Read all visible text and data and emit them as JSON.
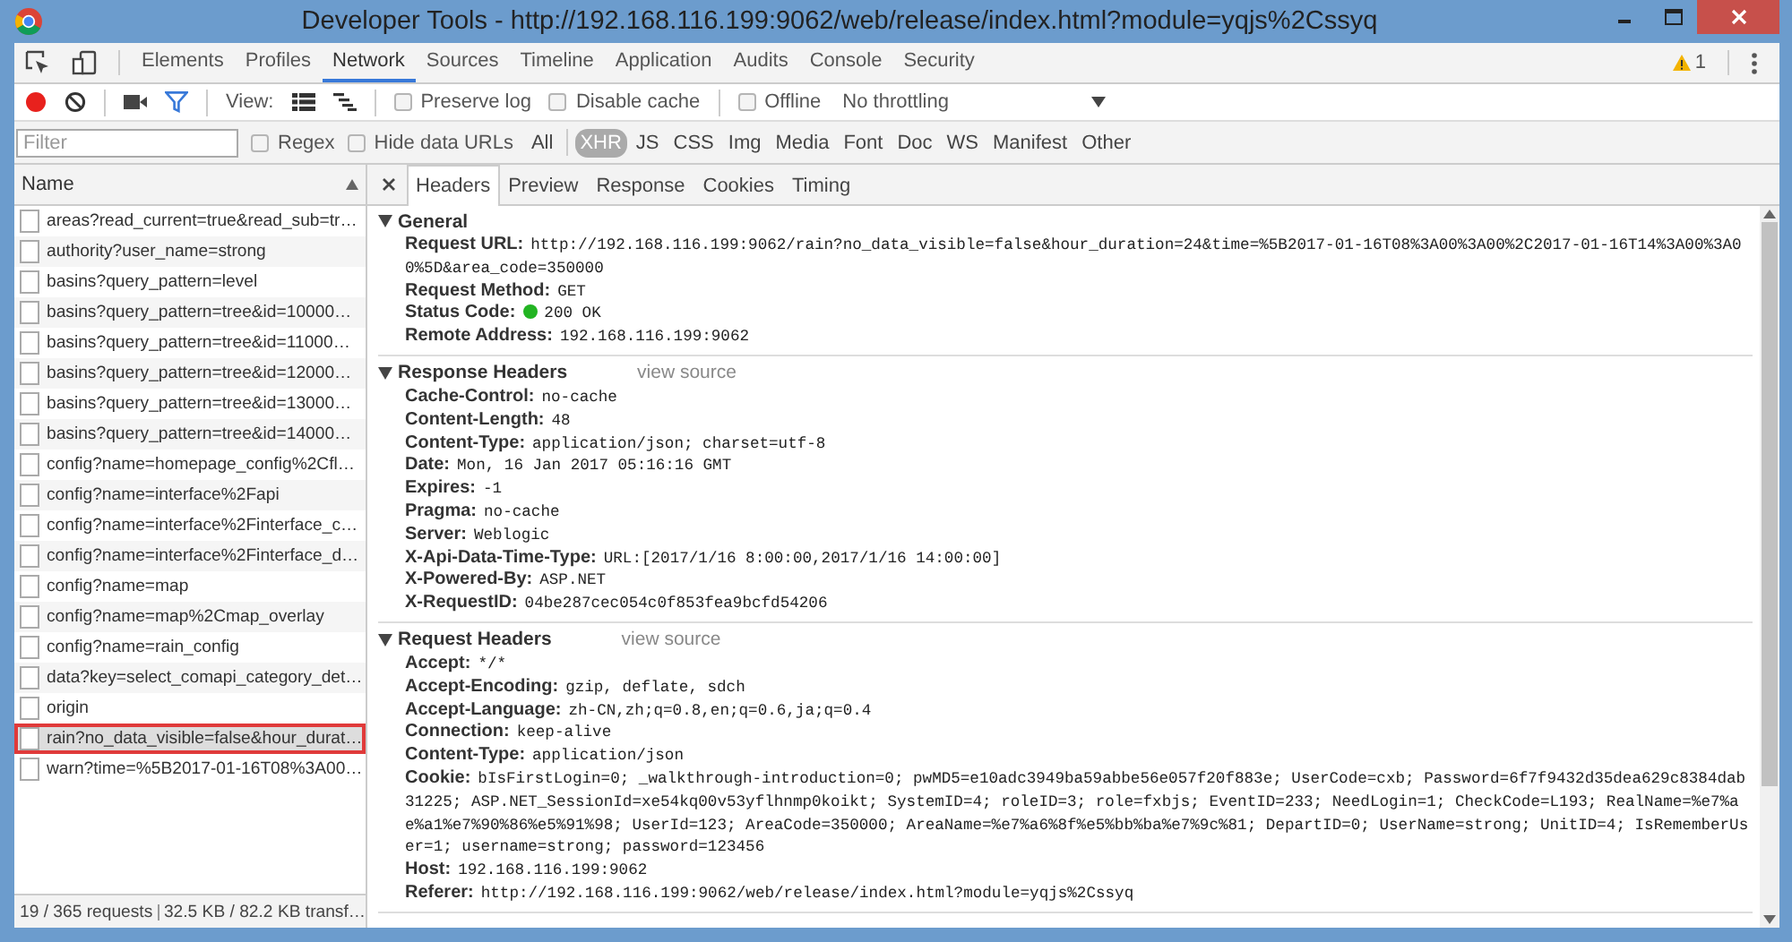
{
  "window": {
    "title": "Developer Tools - http://192.168.116.199:9062/web/release/index.html?module=yqjs%2Cssyq"
  },
  "tabs": [
    {
      "label": "Elements",
      "selected": false
    },
    {
      "label": "Profiles",
      "selected": false
    },
    {
      "label": "Network",
      "selected": true
    },
    {
      "label": "Sources",
      "selected": false
    },
    {
      "label": "Timeline",
      "selected": false
    },
    {
      "label": "Application",
      "selected": false
    },
    {
      "label": "Audits",
      "selected": false
    },
    {
      "label": "Console",
      "selected": false
    },
    {
      "label": "Security",
      "selected": false
    }
  ],
  "warning_count": "1",
  "toolbar": {
    "recording": true,
    "filter_active": true,
    "view_label": "View:",
    "options": [
      {
        "label": "Preserve log",
        "checked": false
      },
      {
        "label": "Disable cache",
        "checked": false
      },
      {
        "label": "Offline",
        "checked": false
      }
    ],
    "throttling": "No throttling"
  },
  "filter_bar": {
    "placeholder": "Filter",
    "options": [
      {
        "label": "Regex",
        "checked": false
      },
      {
        "label": "Hide data URLs",
        "checked": false
      }
    ],
    "types": [
      {
        "label": "All",
        "selected": false
      },
      {
        "label": "XHR",
        "selected": true
      },
      {
        "label": "JS",
        "selected": false
      },
      {
        "label": "CSS",
        "selected": false
      },
      {
        "label": "Img",
        "selected": false
      },
      {
        "label": "Media",
        "selected": false
      },
      {
        "label": "Font",
        "selected": false
      },
      {
        "label": "Doc",
        "selected": false
      },
      {
        "label": "WS",
        "selected": false
      },
      {
        "label": "Manifest",
        "selected": false
      },
      {
        "label": "Other",
        "selected": false
      }
    ]
  },
  "requests": {
    "column": "Name",
    "items": [
      {
        "name": "areas?read_current=true&read_sub=tr…",
        "selected": false
      },
      {
        "name": "authority?user_name=strong",
        "selected": false
      },
      {
        "name": "basins?query_pattern=level",
        "selected": false
      },
      {
        "name": "basins?query_pattern=tree&id=10000…",
        "selected": false
      },
      {
        "name": "basins?query_pattern=tree&id=11000…",
        "selected": false
      },
      {
        "name": "basins?query_pattern=tree&id=12000…",
        "selected": false
      },
      {
        "name": "basins?query_pattern=tree&id=13000…",
        "selected": false
      },
      {
        "name": "basins?query_pattern=tree&id=14000…",
        "selected": false
      },
      {
        "name": "config?name=homepage_config%2Cfl…",
        "selected": false
      },
      {
        "name": "config?name=interface%2Fapi",
        "selected": false
      },
      {
        "name": "config?name=interface%2Finterface_c…",
        "selected": false
      },
      {
        "name": "config?name=interface%2Finterface_d…",
        "selected": false
      },
      {
        "name": "config?name=map",
        "selected": false
      },
      {
        "name": "config?name=map%2Cmap_overlay",
        "selected": false
      },
      {
        "name": "config?name=rain_config",
        "selected": false
      },
      {
        "name": "data?key=select_comapi_category_det…",
        "selected": false
      },
      {
        "name": "origin",
        "selected": false
      },
      {
        "name": "rain?no_data_visible=false&hour_durat…",
        "selected": true
      },
      {
        "name": "warn?time=%5B2017-01-16T08%3A00…",
        "selected": false
      }
    ],
    "summary": "19 / 365 requests",
    "transfer": "32.5 KB / 82.2 KB transf…"
  },
  "details": {
    "tabs": [
      {
        "label": "Headers",
        "selected": true
      },
      {
        "label": "Preview",
        "selected": false
      },
      {
        "label": "Response",
        "selected": false
      },
      {
        "label": "Cookies",
        "selected": false
      },
      {
        "label": "Timing",
        "selected": false
      }
    ],
    "sections": [
      {
        "title": "General",
        "expanded": true,
        "rows": [
          {
            "key": "Request URL:",
            "value": "http://192.168.116.199:9062/rain?no_data_visible=false&hour_duration=24&time=%5B2017-01-16T08%3A00%3A00%2C2017-01-16T14%3A00%3A00%5D&area_code=350000"
          },
          {
            "key": "Request Method:",
            "value": "GET"
          },
          {
            "key": "Status Code:",
            "value": "200 OK",
            "kind": "status",
            "color": "#22b422"
          },
          {
            "key": "Remote Address:",
            "value": "192.168.116.199:9062"
          }
        ]
      },
      {
        "title": "Response Headers",
        "expanded": true,
        "view_source": "view source",
        "rows": [
          {
            "key": "Cache-Control:",
            "value": "no-cache"
          },
          {
            "key": "Content-Length:",
            "value": "48"
          },
          {
            "key": "Content-Type:",
            "value": "application/json; charset=utf-8"
          },
          {
            "key": "Date:",
            "value": "Mon, 16 Jan 2017 05:16:16 GMT"
          },
          {
            "key": "Expires:",
            "value": "-1"
          },
          {
            "key": "Pragma:",
            "value": "no-cache"
          },
          {
            "key": "Server:",
            "value": "Weblogic"
          },
          {
            "key": "X-Api-Data-Time-Type:",
            "value": "URL:[2017/1/16 8:00:00,2017/1/16 14:00:00]"
          },
          {
            "key": "X-Powered-By:",
            "value": "ASP.NET"
          },
          {
            "key": "X-RequestID:",
            "value": "04be287cec054c0f853fea9bcfd54206"
          }
        ]
      },
      {
        "title": "Request Headers",
        "expanded": true,
        "view_source": "view source",
        "rows": [
          {
            "key": "Accept:",
            "value": "*/*"
          },
          {
            "key": "Accept-Encoding:",
            "value": "gzip, deflate, sdch"
          },
          {
            "key": "Accept-Language:",
            "value": "zh-CN,zh;q=0.8,en;q=0.6,ja;q=0.4"
          },
          {
            "key": "Connection:",
            "value": "keep-alive"
          },
          {
            "key": "Content-Type:",
            "value": "application/json"
          },
          {
            "key": "Cookie:",
            "value": "bIsFirstLogin=0; _walkthrough-introduction=0; pwMD5=e10adc3949ba59abbe56e057f20f883e; UserCode=cxb; Password=6f7f9432d35dea629c8384dab31225; ASP.NET_SessionId=xe54kq00v53yflhnmp0koikt; SystemID=4; roleID=3; role=fxbjs; EventID=233; NeedLogin=1; CheckCode=L193; RealName=%e7%ae%a1%e7%90%86%e5%91%98; UserId=123; AreaCode=350000; AreaName=%e7%a6%8f%e5%bb%ba%e7%9c%81; DepartID=0; UserName=strong; UnitID=4; IsRememberUser=1; username=strong; password=123456"
          },
          {
            "key": "Host:",
            "value": "192.168.116.199:9062"
          },
          {
            "key": "Referer:",
            "value": "http://192.168.116.199:9062/web/release/index.html?module=yqjs%2Cssyq"
          }
        ]
      }
    ]
  }
}
